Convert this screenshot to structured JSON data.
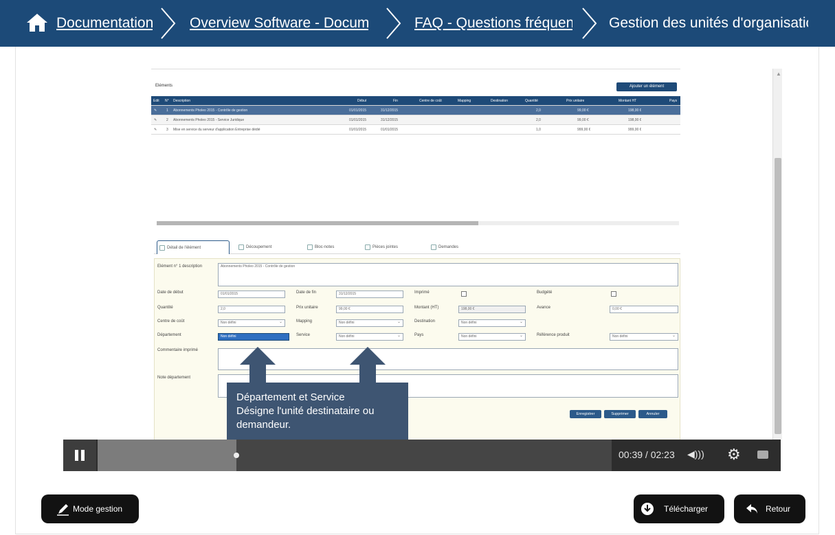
{
  "breadcrumb": {
    "items": [
      {
        "label": "Documentation",
        "link": true
      },
      {
        "label": "Overview Software - Documentation",
        "link": true
      },
      {
        "label": "FAQ - Questions fréquentes",
        "link": true
      },
      {
        "label": "Gestion des unités d'organisation",
        "link": false
      }
    ]
  },
  "app": {
    "elements_title": "Eléments",
    "add_button": "Ajouter un élément",
    "columns": [
      "Edit",
      "N°",
      "Description",
      "Début",
      "Fin",
      "Centre de coût",
      "Mapping",
      "Destination",
      "Quantité",
      "Prix unitaire",
      "Montant HT",
      "Pays"
    ],
    "rows": [
      {
        "n": "1",
        "description": "Abonnements Pholeo 2015 - Contrôle de gestion",
        "debut": "01/01/2015",
        "fin": "31/12/2015",
        "quantite": "2,0",
        "prix": "99,00 €",
        "montant": "198,00 €"
      },
      {
        "n": "2",
        "description": "Abonnements Pholeo 2015 - Service Juridique",
        "debut": "01/01/2015",
        "fin": "31/12/2015",
        "quantite": "2,0",
        "prix": "99,00 €",
        "montant": "198,00 €"
      },
      {
        "n": "3",
        "description": "Mise en service du serveur d'application Entreprise dédié",
        "debut": "01/01/2015",
        "fin": "01/01/2015",
        "quantite": "1,0",
        "prix": "999,00 €",
        "montant": "999,00 €"
      }
    ],
    "tabs": [
      "Détail de l'élément",
      "Découpement",
      "Bloc-notes",
      "Pièces jointes",
      "Demandes"
    ],
    "form": {
      "description_label": "Elément n° 1 description",
      "description_value": "Abonnements Pholeo 2015 - Contrôle de gestion",
      "date_debut_label": "Date de début",
      "date_debut_value": "01/01/2015",
      "date_fin_label": "Date de fin",
      "date_fin_value": "31/12/2015",
      "imprime_label": "Imprimé",
      "budgete_label": "Budgété",
      "quantite_label": "Quantité",
      "quantite_value": "2,0",
      "prix_label": "Prix unitaire",
      "prix_value": "99,00 €",
      "montant_label": "Montant (HT)",
      "montant_value": "198,00 €",
      "avance_label": "Avance",
      "avance_value": "0,00 €",
      "centre_label": "Centre de coût",
      "centre_value": "Non défini",
      "mapping_label": "Mapping",
      "mapping_value": "Non défini",
      "destination_label": "Destination",
      "destination_value": "Non défini",
      "departement_label": "Département",
      "departement_value": "Non défini",
      "service_label": "Service",
      "service_value": "Non défini",
      "pays_label": "Pays",
      "pays_value": "Non défini",
      "reference_label": "Référence produit",
      "reference_value": "Non défini",
      "commentaire_label": "Commentaire imprimé",
      "note_label": "Note département",
      "save": "Enregistrer",
      "delete": "Supprimer",
      "cancel": "Annuler"
    }
  },
  "callout": {
    "title": "Département et Service",
    "body": "Désigne l'unité destinataire ou demandeur."
  },
  "player": {
    "time": "00:39 / 02:23",
    "progress": 0.27
  },
  "buttons": {
    "mode_gestion": "Mode gestion",
    "telecharger": "Télécharger",
    "retour": "Retour"
  }
}
